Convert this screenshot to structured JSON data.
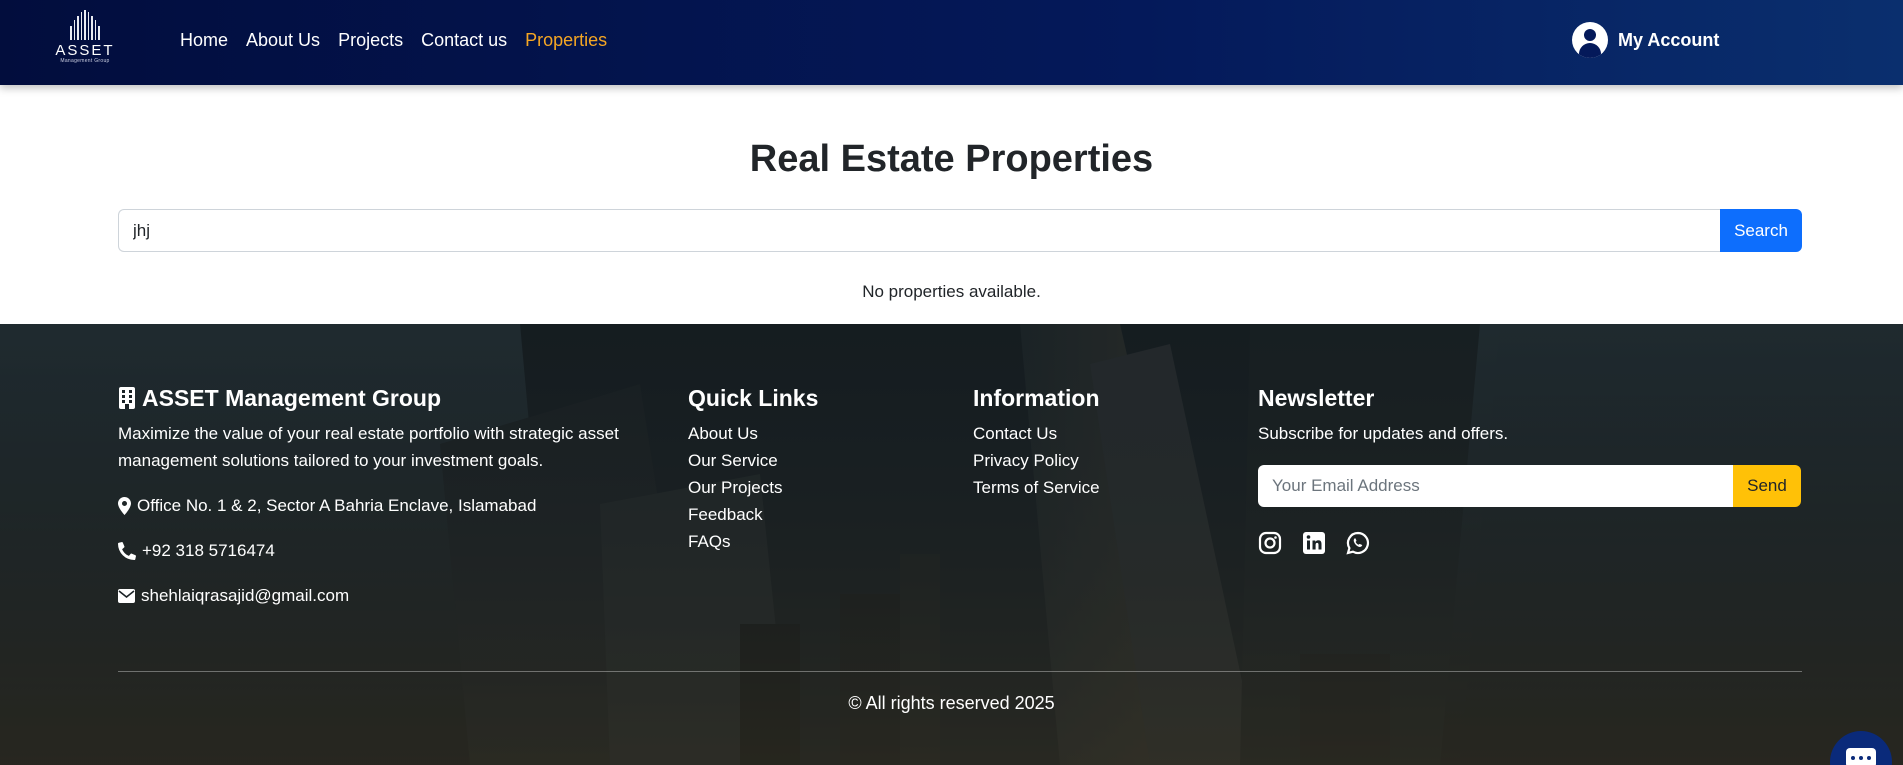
{
  "navbar": {
    "logo_text": "ASSET",
    "logo_subtext": "Management Group",
    "links": [
      {
        "label": "Home"
      },
      {
        "label": "About Us"
      },
      {
        "label": "Projects"
      },
      {
        "label": "Contact us"
      },
      {
        "label": "Properties",
        "active": true
      }
    ],
    "account_label": "My Account"
  },
  "main": {
    "title": "Real Estate Properties",
    "search_value": "jhj",
    "search_button": "Search",
    "empty_message": "No properties available."
  },
  "footer": {
    "brand": {
      "title": "ASSET Management Group",
      "description": "Maximize the value of your real estate portfolio with strategic asset management solutions tailored to your investment goals.",
      "address": "Office No. 1 & 2, Sector A Bahria Enclave, Islamabad",
      "phone": "+92 318 5716474",
      "email": "shehlaiqrasajid@gmail.com"
    },
    "quick_links": {
      "title": "Quick Links",
      "items": [
        "About Us",
        "Our Service",
        "Our Projects",
        "Feedback",
        "FAQs"
      ]
    },
    "information": {
      "title": "Information",
      "items": [
        "Contact Us",
        "Privacy Policy",
        "Terms of Service"
      ]
    },
    "newsletter": {
      "title": "Newsletter",
      "text": "Subscribe for updates and offers.",
      "placeholder": "Your Email Address",
      "button": "Send",
      "socials": [
        "instagram-icon",
        "linkedin-icon",
        "whatsapp-icon"
      ]
    },
    "copyright": "© All rights reserved 2025"
  },
  "colors": {
    "nav_bg": "#04195a",
    "active_link": "#f5a623",
    "primary_button": "#0d6efd",
    "send_button": "#ffc107"
  }
}
